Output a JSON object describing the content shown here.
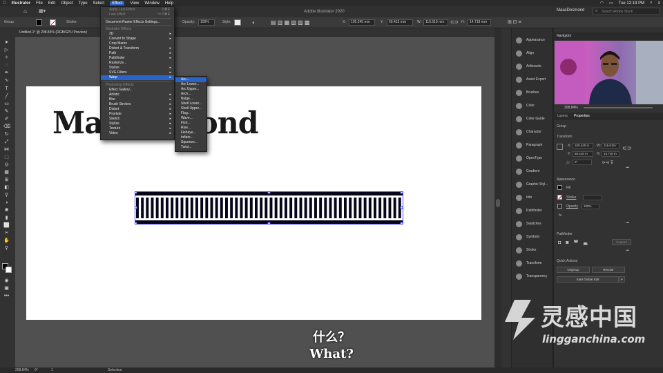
{
  "mac_menubar": {
    "items": [
      "Illustrator",
      "File",
      "Edit",
      "Object",
      "Type",
      "Select",
      "Effect",
      "View",
      "Window",
      "Help"
    ],
    "active_item": "Effect",
    "clock": "Tue 12:19 PM",
    "user": "MaacDesmond"
  },
  "app_titlebar": {
    "title": "Adobe Illustrator 2020",
    "search_placeholder": "Search Adobe Stock"
  },
  "control_bar": {
    "selection_label": "Group",
    "stroke_label": "Stroke:",
    "opacity_label": "Opacity:",
    "opacity_value": "100%",
    "style_label": "Style:",
    "x_label": "X:",
    "x_value": "105.245 mm",
    "y_label": "Y:",
    "y_value": "60.415 mm",
    "w_label": "W:",
    "w_value": "116.619 mm",
    "h_label": "H:",
    "h_value": "14.718 mm"
  },
  "document_tab": {
    "title": "Untitled-1* @ 208.84% (RGB/GPU Preview)"
  },
  "artboard": {
    "heading_text": "MaacDesmond",
    "heading_visible_left": "Ma",
    "heading_visible_right": "mond"
  },
  "effect_menu": {
    "items": [
      {
        "label": "Apply Last Effect",
        "shortcut": "⇧⌘E",
        "disabled": true
      },
      {
        "label": "Last Effect",
        "shortcut": "⌥⇧⌘E",
        "disabled": true
      },
      {
        "label": "Document Raster Effects Settings...",
        "disabled": false
      },
      {
        "label": "Illustrator Effects",
        "header": true
      },
      {
        "label": "3D",
        "submenu": true
      },
      {
        "label": "Convert to Shape",
        "submenu": true
      },
      {
        "label": "Crop Marks"
      },
      {
        "label": "Distort & Transform",
        "submenu": true
      },
      {
        "label": "Path",
        "submenu": true
      },
      {
        "label": "Pathfinder",
        "submenu": true
      },
      {
        "label": "Rasterize..."
      },
      {
        "label": "Stylize",
        "submenu": true
      },
      {
        "label": "SVG Filters",
        "submenu": true
      },
      {
        "label": "Warp",
        "submenu": true,
        "highlighted": true
      },
      {
        "label": "Photoshop Effects",
        "header": true
      },
      {
        "label": "Effect Gallery..."
      },
      {
        "label": "Artistic",
        "submenu": true
      },
      {
        "label": "Blur",
        "submenu": true
      },
      {
        "label": "Brush Strokes",
        "submenu": true
      },
      {
        "label": "Distort",
        "submenu": true
      },
      {
        "label": "Pixelate",
        "submenu": true
      },
      {
        "label": "Sketch",
        "submenu": true
      },
      {
        "label": "Stylize",
        "submenu": true
      },
      {
        "label": "Texture",
        "submenu": true
      },
      {
        "label": "Video",
        "submenu": true
      }
    ]
  },
  "warp_submenu": {
    "items": [
      "Arc...",
      "Arc Lower...",
      "Arc Upper...",
      "Arch...",
      "Bulge...",
      "Shell Lower...",
      "Shell Upper...",
      "Flag...",
      "Wave...",
      "Fish...",
      "Rise...",
      "Fisheye...",
      "Inflate...",
      "Squeeze...",
      "Twist..."
    ],
    "highlighted": "Arc..."
  },
  "icon_panel": {
    "items": [
      {
        "label": "Appearance",
        "icon": "appearance-icon"
      },
      {
        "label": "Align",
        "icon": "align-icon"
      },
      {
        "label": "Artboards",
        "icon": "artboards-icon"
      },
      {
        "label": "Asset Export",
        "icon": "asset-export-icon"
      },
      {
        "label": "Brushes",
        "icon": "brushes-icon"
      },
      {
        "label": "Color",
        "icon": "color-icon"
      },
      {
        "label": "Color Guide",
        "icon": "color-guide-icon"
      },
      {
        "label": "Character",
        "icon": "character-icon"
      },
      {
        "label": "Paragraph",
        "icon": "paragraph-icon"
      },
      {
        "label": "OpenType",
        "icon": "opentype-icon"
      },
      {
        "label": "Gradient",
        "icon": "gradient-icon"
      },
      {
        "label": "Graphic Styl...",
        "icon": "graphic-styles-icon"
      },
      {
        "label": "Info",
        "icon": "info-icon"
      },
      {
        "label": "Pathfinder",
        "icon": "pathfinder-icon"
      },
      {
        "label": "Swatches",
        "icon": "swatches-icon"
      },
      {
        "label": "Symbols",
        "icon": "symbols-icon"
      },
      {
        "label": "Stroke",
        "icon": "stroke-icon"
      },
      {
        "label": "Transform",
        "icon": "transform-icon"
      },
      {
        "label": "Transparency",
        "icon": "transparency-icon"
      }
    ]
  },
  "navigator": {
    "title": "Navigator",
    "zoom": "208.84%"
  },
  "properties_panel": {
    "tabs": [
      "Layers",
      "Properties"
    ],
    "active_tab": "Properties",
    "selection": "Group",
    "transform_title": "Transform",
    "x_label": "X:",
    "x_value": "105.245 m",
    "y_label": "Y:",
    "y_value": "60.415 m",
    "w_label": "W:",
    "w_value": "116.619 r",
    "h_label": "H:",
    "h_value": "14.718 m",
    "rotate_label": "△:",
    "rotate_value": "0°",
    "appearance_title": "Appearance",
    "fill_label": "Fill",
    "stroke_label": "Stroke",
    "opacity_label": "Opacity",
    "opacity_value": "100%",
    "fx_label": "fx.",
    "pathfinder_title": "Pathfinder",
    "expand_label": "Expand",
    "quick_actions_title": "Quick Actions",
    "ungroup_label": "Ungroup",
    "recolor_label": "Recolor",
    "global_edit_label": "Start Global Edit",
    "more_label": "•••"
  },
  "status_bar": {
    "zoom": "208.84%",
    "angle": "0°",
    "artboard_num": "1",
    "tool": "Selection"
  },
  "subtitles": {
    "chinese": "什么？",
    "english": "What?"
  },
  "watermark": {
    "chinese": "灵感中国",
    "url": "lingganchina.com"
  },
  "colors": {
    "menu_highlight": "#2b64c8",
    "panel_bg": "#323232",
    "artboard_bg": "#ffffff",
    "selection_blue": "#4a4af0"
  }
}
